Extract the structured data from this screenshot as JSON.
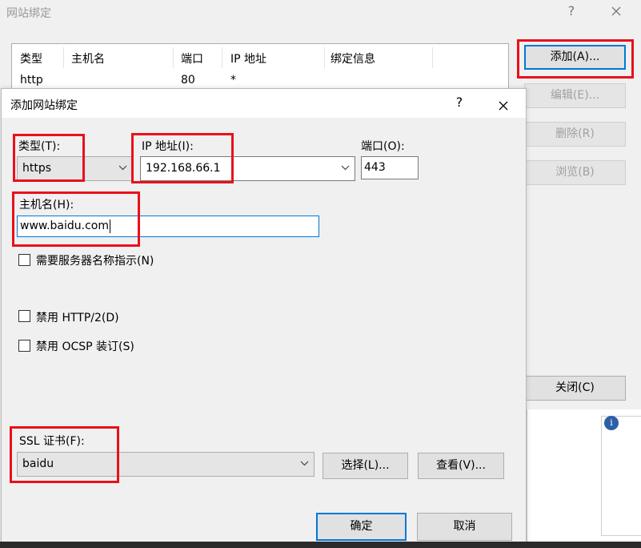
{
  "window": {
    "title": "网站绑定",
    "help_glyph": "?"
  },
  "bindings_table": {
    "columns": [
      "类型",
      "主机名",
      "端口",
      "IP 地址",
      "绑定信息"
    ],
    "rows": [
      [
        "http",
        "",
        "80",
        "*",
        ""
      ]
    ]
  },
  "side_buttons": {
    "add": "添加(A)...",
    "edit": "编辑(E)...",
    "remove": "删除(R)",
    "browse": "浏览(B)",
    "close": "关闭(C)"
  },
  "dialog": {
    "title": "添加网站绑定",
    "help_glyph": "?",
    "type_label": "类型(T):",
    "type_value": "https",
    "ip_label": "IP 地址(I):",
    "ip_value": "192.168.66.1",
    "port_label": "端口(O):",
    "port_value": "443",
    "host_label": "主机名(H):",
    "host_value": "www.baidu.com",
    "sni_label": "需要服务器名称指示(N)",
    "disable_http2_label": "禁用 HTTP/2(D)",
    "disable_ocsp_label": "禁用 OCSP 装订(S)",
    "ssl_label": "SSL 证书(F):",
    "ssl_value": "baidu",
    "select_button": "选择(L)...",
    "view_button": "查看(V)...",
    "ok_button": "确定",
    "cancel_button": "取消"
  },
  "colors": {
    "highlight": "#e8111b",
    "focus": "#0078d7"
  }
}
